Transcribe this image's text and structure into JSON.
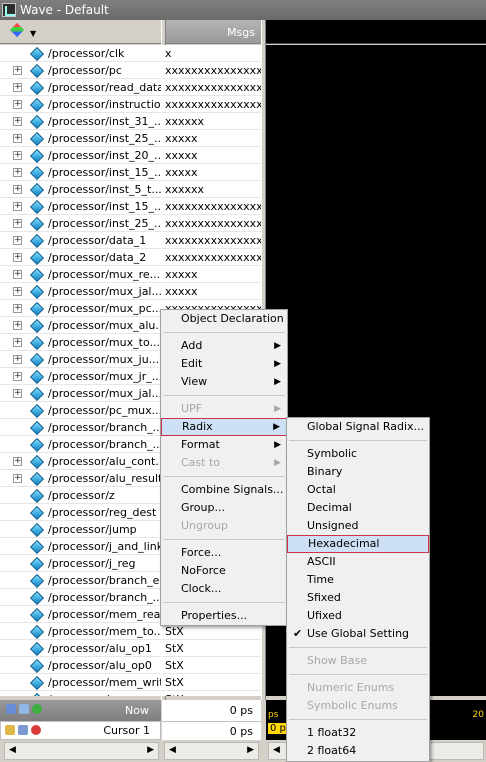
{
  "window": {
    "title": "Wave - Default"
  },
  "header": {
    "msgs_label": "Msgs"
  },
  "signals": [
    {
      "name": "/processor/clk",
      "value": "x",
      "expandable": false
    },
    {
      "name": "/processor/pc",
      "value": "xxxxxxxxxxxxxxx...",
      "expandable": true
    },
    {
      "name": "/processor/read_data",
      "value": "xxxxxxxxxxxxxxx...",
      "expandable": true
    },
    {
      "name": "/processor/instruction",
      "value": "xxxxxxxxxxxxxxx...",
      "expandable": true
    },
    {
      "name": "/processor/inst_31_...",
      "value": "xxxxxx",
      "expandable": true
    },
    {
      "name": "/processor/inst_25_...",
      "value": "xxxxx",
      "expandable": true
    },
    {
      "name": "/processor/inst_20_...",
      "value": "xxxxx",
      "expandable": true
    },
    {
      "name": "/processor/inst_15_...",
      "value": "xxxxx",
      "expandable": true
    },
    {
      "name": "/processor/inst_5_t...",
      "value": "xxxxxx",
      "expandable": true
    },
    {
      "name": "/processor/inst_15_...",
      "value": "xxxxxxxxxxxxxxxx",
      "expandable": true
    },
    {
      "name": "/processor/inst_25_...",
      "value": "xxxxxxxxxxxxxxx...",
      "expandable": true
    },
    {
      "name": "/processor/data_1",
      "value": "xxxxxxxxxxxxxxx...",
      "expandable": true
    },
    {
      "name": "/processor/data_2",
      "value": "xxxxxxxxxxxxxxx...",
      "expandable": true
    },
    {
      "name": "/processor/mux_re...",
      "value": "xxxxx",
      "expandable": true
    },
    {
      "name": "/processor/mux_jal...",
      "value": "xxxxx",
      "expandable": true
    },
    {
      "name": "/processor/mux_pc...",
      "value": "xxxxxxxxxxxxxxx",
      "expandable": true
    },
    {
      "name": "/processor/mux_alu...",
      "value": "",
      "expandable": true
    },
    {
      "name": "/processor/mux_to...",
      "value": "",
      "expandable": true
    },
    {
      "name": "/processor/mux_ju...",
      "value": "",
      "expandable": true
    },
    {
      "name": "/processor/mux_jr_...",
      "value": "",
      "expandable": true
    },
    {
      "name": "/processor/mux_jal...",
      "value": "",
      "expandable": true
    },
    {
      "name": "/processor/pc_mux...",
      "value": "",
      "expandable": false
    },
    {
      "name": "/processor/branch_...",
      "value": "",
      "expandable": false
    },
    {
      "name": "/processor/branch_...",
      "value": "",
      "expandable": false
    },
    {
      "name": "/processor/alu_cont...",
      "value": "",
      "expandable": true
    },
    {
      "name": "/processor/alu_result",
      "value": "",
      "expandable": true
    },
    {
      "name": "/processor/z",
      "value": "",
      "expandable": false
    },
    {
      "name": "/processor/reg_dest",
      "value": "",
      "expandable": false
    },
    {
      "name": "/processor/jump",
      "value": "",
      "expandable": false
    },
    {
      "name": "/processor/j_and_link",
      "value": "",
      "expandable": false
    },
    {
      "name": "/processor/j_reg",
      "value": "",
      "expandable": false
    },
    {
      "name": "/processor/branch_eq",
      "value": "",
      "expandable": false
    },
    {
      "name": "/processor/branch_...",
      "value": "",
      "expandable": false
    },
    {
      "name": "/processor/mem_read",
      "value": "",
      "expandable": false
    },
    {
      "name": "/processor/mem_to...",
      "value": "StX",
      "expandable": false
    },
    {
      "name": "/processor/alu_op1",
      "value": "StX",
      "expandable": false
    },
    {
      "name": "/processor/alu_op0",
      "value": "StX",
      "expandable": false
    },
    {
      "name": "/processor/mem_write",
      "value": "StX",
      "expandable": false
    },
    {
      "name": "/processor/...",
      "value": "StX",
      "expandable": false
    }
  ],
  "bottom": {
    "now_label": "Now",
    "now_value": "0 ps",
    "cursor_label": "Cursor 1",
    "cursor_value": "0 ps",
    "time_start": "ps",
    "time_end": "20",
    "cursor_tag": "0 p"
  },
  "context_menu": {
    "object_declaration": "Object Declaration",
    "add": "Add",
    "edit": "Edit",
    "view": "View",
    "upf": "UPF",
    "radix": "Radix",
    "format": "Format",
    "cast_to": "Cast to",
    "combine_signals": "Combine Signals...",
    "group": "Group...",
    "ungroup": "Ungroup",
    "force": "Force...",
    "noforce": "NoForce",
    "clock": "Clock...",
    "properties": "Properties..."
  },
  "radix_menu": {
    "global_signal_radix": "Global Signal Radix...",
    "symbolic": "Symbolic",
    "binary": "Binary",
    "octal": "Octal",
    "decimal": "Decimal",
    "unsigned": "Unsigned",
    "hexadecimal": "Hexadecimal",
    "ascii": "ASCII",
    "time": "Time",
    "sfixed": "Sfixed",
    "ufixed": "Ufixed",
    "use_global_setting": "Use Global Setting",
    "show_base": "Show Base",
    "numeric_enums": "Numeric Enums",
    "symbolic_enums": "Symbolic Enums",
    "float32": "1 float32",
    "float64": "2 float64"
  },
  "colors": {
    "wave_bg": "#000000",
    "selection_bg": "#cde0f5",
    "selection_border": "#c9344a",
    "cursor_yellow": "#ffd800"
  }
}
